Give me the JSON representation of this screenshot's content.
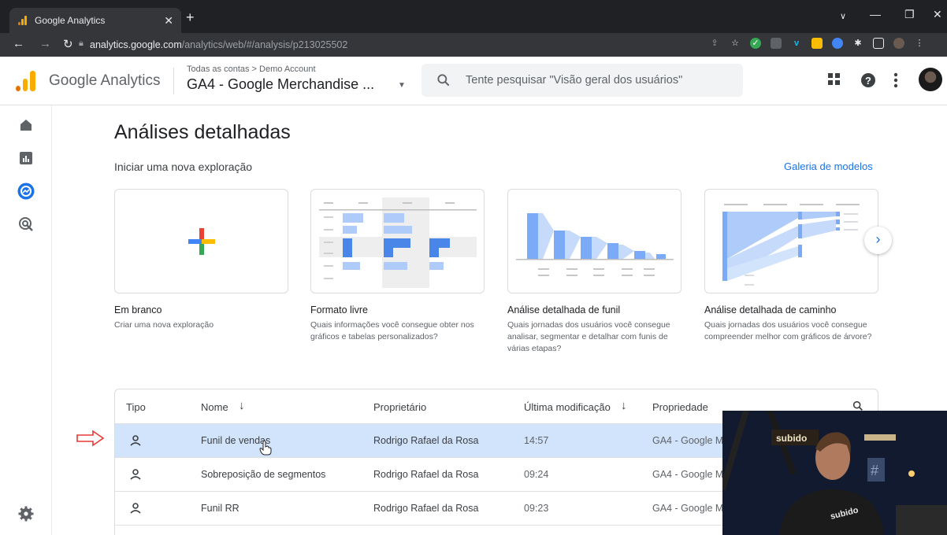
{
  "browser": {
    "tab_title": "Google Analytics",
    "url_host": "analytics.google.com",
    "url_path": "/analytics/web/#/analysis/p213025502"
  },
  "header": {
    "product_name": "Google Analytics",
    "breadcrumb": "Todas as contas > Demo Account",
    "property": "GA4 - Google Merchandise ...",
    "search_placeholder": "Tente pesquisar \"Visão geral dos usuários\""
  },
  "page": {
    "title": "Análises detalhadas",
    "subtitle": "Iniciar uma nova exploração",
    "gallery_link": "Galeria de modelos"
  },
  "templates": [
    {
      "title": "Em branco",
      "desc": "Criar uma nova exploração"
    },
    {
      "title": "Formato livre",
      "desc": "Quais informações você consegue obter nos gráficos e tabelas personalizados?"
    },
    {
      "title": "Análise detalhada de funil",
      "desc": "Quais jornadas dos usuários você consegue analisar, segmentar e detalhar com funis de várias etapas?"
    },
    {
      "title": "Análise detalhada de caminho",
      "desc": "Quais jornadas dos usuários você consegue compreender melhor com gráficos de árvore?"
    }
  ],
  "table": {
    "headers": {
      "type": "Tipo",
      "name": "Nome",
      "owner": "Proprietário",
      "modified": "Última modificação",
      "property": "Propriedade"
    },
    "rows": [
      {
        "name": "Funil de vendas",
        "owner": "Rodrigo Rafael da Rosa",
        "modified": "14:57",
        "property": "GA4 - Google Me"
      },
      {
        "name": "Sobreposição de segmentos",
        "owner": "Rodrigo Rafael da Rosa",
        "modified": "09:24",
        "property": "GA4 - Google Me"
      },
      {
        "name": "Funil RR",
        "owner": "Rodrigo Rafael da Rosa",
        "modified": "09:23",
        "property": "GA4 - Google Me"
      }
    ]
  },
  "overlay": {
    "shirt_text": "subido",
    "sign_text": "subido"
  },
  "colors": {
    "accent": "#1a73e8",
    "selected_row": "#d2e3fc",
    "ga_orange": "#f9ab00",
    "ga_dark_orange": "#e37400"
  }
}
